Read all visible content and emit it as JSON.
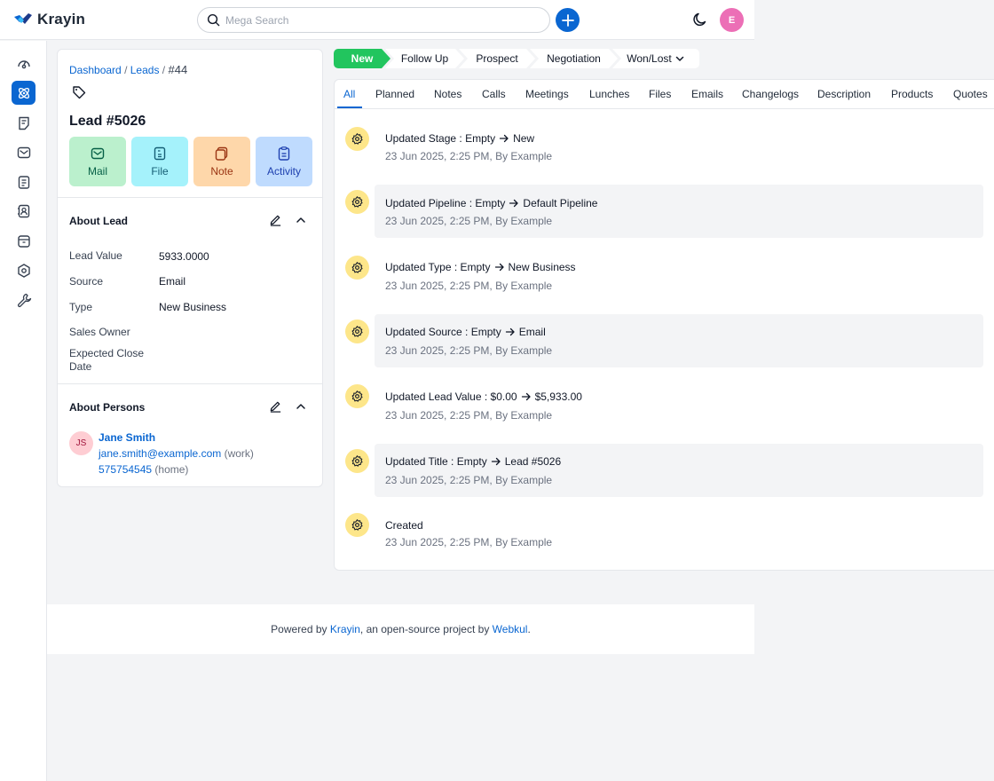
{
  "app": {
    "name": "Krayin"
  },
  "header": {
    "search_placeholder": "Mega Search",
    "user_initial": "E"
  },
  "breadcrumb": {
    "dashboard": "Dashboard",
    "leads": "Leads",
    "current": "#44",
    "sep": "/"
  },
  "lead": {
    "title": "Lead #5026",
    "actions": {
      "mail": "Mail",
      "file": "File",
      "note": "Note",
      "activity": "Activity"
    }
  },
  "about_lead": {
    "title": "About Lead",
    "fields": [
      {
        "label": "Lead Value",
        "value": "5933.0000"
      },
      {
        "label": "Source",
        "value": "Email"
      },
      {
        "label": "Type",
        "value": "New Business"
      },
      {
        "label": "Sales Owner",
        "value": ""
      },
      {
        "label": "Expected Close Date",
        "value": ""
      }
    ]
  },
  "about_persons": {
    "title": "About Persons",
    "person": {
      "initials": "JS",
      "name": "Jane Smith",
      "email": "jane.smith@example.com",
      "email_type": "(work)",
      "phone": "575754545",
      "phone_type": "(home)"
    }
  },
  "stages": [
    "New",
    "Follow Up",
    "Prospect",
    "Negotiation",
    "Won/Lost"
  ],
  "tabs": [
    "All",
    "Planned",
    "Notes",
    "Calls",
    "Meetings",
    "Lunches",
    "Files",
    "Emails",
    "Changelogs",
    "Description",
    "Products",
    "Quotes"
  ],
  "activities": [
    {
      "title": "Updated Stage : Empty",
      "to": "New",
      "meta": "23 Jun 2025, 2:25 PM, By Example"
    },
    {
      "title": "Updated Pipeline : Empty",
      "to": "Default Pipeline",
      "meta": "23 Jun 2025, 2:25 PM, By Example"
    },
    {
      "title": "Updated Type : Empty",
      "to": "New Business",
      "meta": "23 Jun 2025, 2:25 PM, By Example"
    },
    {
      "title": "Updated Source : Empty",
      "to": "Email",
      "meta": "23 Jun 2025, 2:25 PM, By Example"
    },
    {
      "title": "Updated Lead Value : $0.00",
      "to": "$5,933.00",
      "meta": "23 Jun 2025, 2:25 PM, By Example"
    },
    {
      "title": "Updated Title : Empty",
      "to": "Lead #5026",
      "meta": "23 Jun 2025, 2:25 PM, By Example"
    },
    {
      "title": "Created",
      "to": "",
      "meta": "23 Jun 2025, 2:25 PM, By Example"
    }
  ],
  "footer": {
    "prefix": "Powered by",
    "krayin": "Krayin",
    "middle": ", an open-source project by",
    "webkul": "Webkul",
    "suffix": "."
  },
  "colors": {
    "primary": "#0a66d1",
    "stage_active": "#22c55e",
    "activity_icon_bg": "#fde68a"
  }
}
